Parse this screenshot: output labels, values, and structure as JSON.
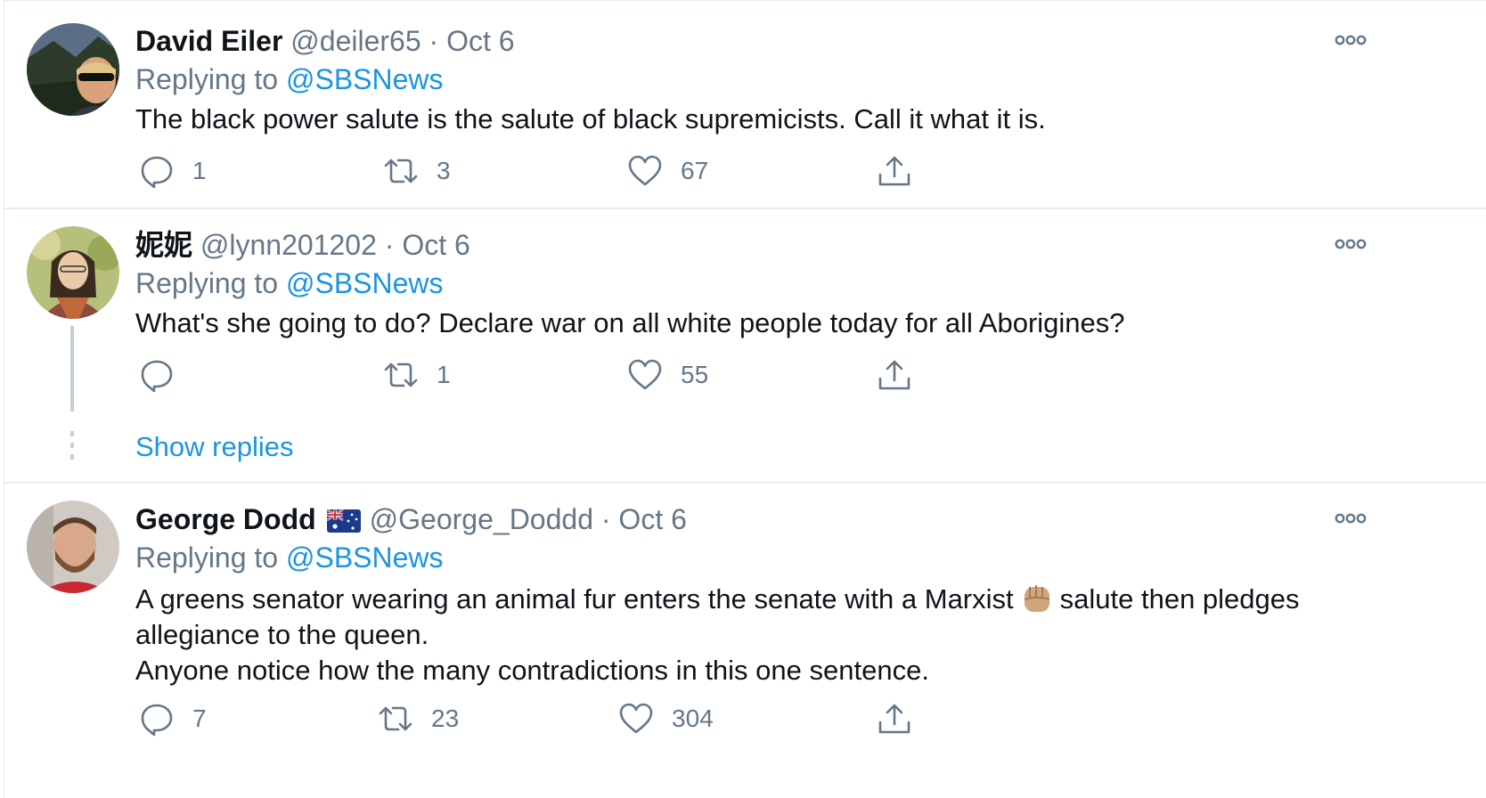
{
  "tweets": [
    {
      "display_name": "David Eiler",
      "handle": "@deiler65",
      "separator": "·",
      "date": "Oct 6",
      "replying_prefix": "Replying to",
      "replying_to": "@SBSNews",
      "text_lines": [
        "The black power salute is the salute of black supremicists. Call it what it is."
      ],
      "reply_count": "1",
      "retweet_count": "3",
      "like_count": "67"
    },
    {
      "display_name": "妮妮",
      "handle": "@lynn201202",
      "separator": "·",
      "date": "Oct 6",
      "replying_prefix": "Replying to",
      "replying_to": "@SBSNews",
      "text_lines": [
        "What's she going to do? Declare war on all white people today for all Aborigines?"
      ],
      "reply_count": "",
      "retweet_count": "1",
      "like_count": "55",
      "show_replies": "Show replies"
    },
    {
      "display_name": "George Dodd",
      "handle": "@George_Doddd",
      "separator": "·",
      "date": "Oct 6",
      "replying_prefix": "Replying to",
      "replying_to": "@SBSNews",
      "text_part1": "A greens senator wearing an animal fur enters the senate with a Marxist",
      "text_part2": "salute then pledges",
      "text_line2": "allegiance to the queen.",
      "text_line3": "Anyone notice how the many contradictions in this one sentence.",
      "reply_count": "7",
      "retweet_count": "23",
      "like_count": "304"
    }
  ],
  "icons": {
    "reply": "reply-icon",
    "retweet": "retweet-icon",
    "like": "heart-icon",
    "share": "share-icon",
    "more": "more-icon",
    "flag": "australia-flag-icon",
    "fist": "raised-fist-icon"
  },
  "colors": {
    "text": "#0f1419",
    "secondary": "#657786",
    "link": "#1b95e0",
    "divider": "#e6ecf0"
  }
}
